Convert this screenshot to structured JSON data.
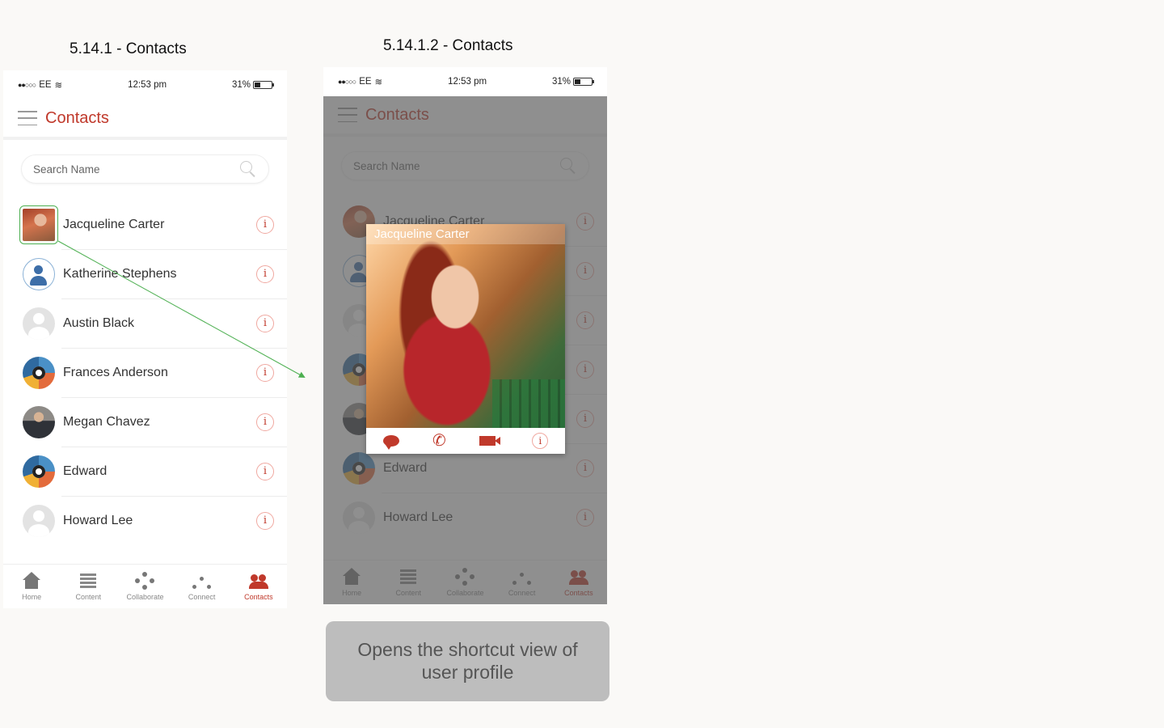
{
  "screens": [
    {
      "title": "5.14.1 - Contacts"
    },
    {
      "title": "5.14.1.2 - Contacts"
    }
  ],
  "status_bar": {
    "carrier": "EE",
    "time": "12:53 pm",
    "battery": "31%"
  },
  "header": {
    "title": "Contacts"
  },
  "search": {
    "placeholder": "Search Name"
  },
  "contacts": [
    {
      "name": "Jacqueline Carter",
      "avatar": "photo-woman"
    },
    {
      "name": "Katherine Stephens",
      "avatar": "blue-user"
    },
    {
      "name": "Austin Black",
      "avatar": "generic-user"
    },
    {
      "name": "Frances Anderson",
      "avatar": "pie-logo"
    },
    {
      "name": "Megan Chavez",
      "avatar": "photo-man"
    },
    {
      "name": "Edward",
      "avatar": "pie-logo"
    },
    {
      "name": "Howard Lee",
      "avatar": "generic-user"
    }
  ],
  "info_label": "i",
  "tabs": [
    {
      "label": "Home",
      "icon": "home-icon",
      "active": false
    },
    {
      "label": "Content",
      "icon": "content-icon",
      "active": false
    },
    {
      "label": "Collaborate",
      "icon": "collab-icon",
      "active": false
    },
    {
      "label": "Connect",
      "icon": "connect-icon",
      "active": false
    },
    {
      "label": "Contacts",
      "icon": "contacts-icon",
      "active": true
    }
  ],
  "profile_card": {
    "name": "Jacqueline Carter",
    "actions": [
      "chat-icon",
      "phone-icon",
      "video-icon",
      "info-icon"
    ]
  },
  "annotation": {
    "text": "Opens the shortcut view of user profile"
  },
  "colors": {
    "accent": "#c0392b",
    "connector": "#4caf50",
    "overlay": "#5a5a5a"
  }
}
